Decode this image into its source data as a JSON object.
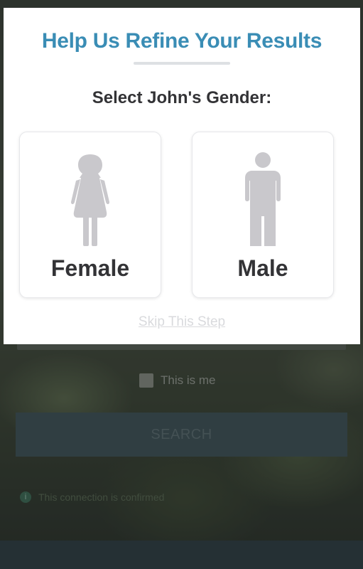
{
  "background": {
    "checkbox_label": "This is me",
    "search_button_label": "SEARCH",
    "info_text": "This connection is confirmed"
  },
  "modal": {
    "title": "Help Us Refine Your Results",
    "question": "Select John's Gender:",
    "options": [
      {
        "label": "Female",
        "icon": "female-figure-icon"
      },
      {
        "label": "Male",
        "icon": "male-figure-icon"
      }
    ],
    "skip_label": "Skip This Step"
  },
  "colors": {
    "title": "#3a8db5",
    "text": "#333336",
    "figure": "#c9c8cc",
    "skip_link": "#d9dadd"
  }
}
